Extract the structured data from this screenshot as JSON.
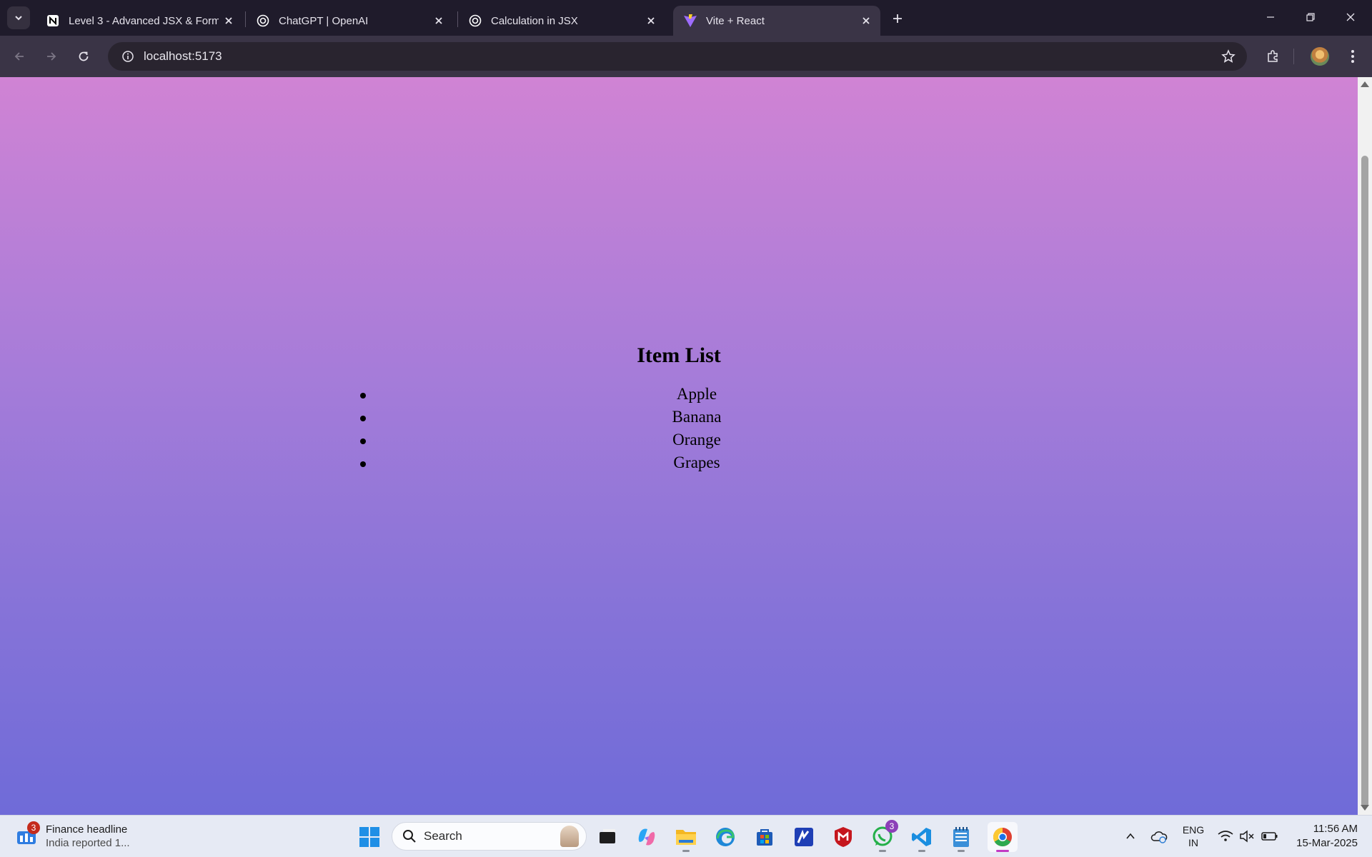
{
  "browser": {
    "tabs": [
      {
        "title": "Level 3 - Advanced JSX & Form",
        "icon": "notion-icon",
        "active": false
      },
      {
        "title": "ChatGPT | OpenAI",
        "icon": "openai-icon",
        "active": false
      },
      {
        "title": "Calculation in JSX",
        "icon": "openai-icon",
        "active": false
      },
      {
        "title": "Vite + React",
        "icon": "vite-icon",
        "active": true
      }
    ],
    "address": "localhost:5173"
  },
  "page": {
    "heading": "Item List",
    "items": [
      "Apple",
      "Banana",
      "Orange",
      "Grapes"
    ],
    "background_top": "#d083d4",
    "background_bottom": "#6f6bd8"
  },
  "taskbar": {
    "widget": {
      "title": "Finance headline",
      "subtitle": "India reported 1...",
      "badge": "3"
    },
    "search_placeholder": "Search",
    "whatsapp_badge": "3",
    "language": {
      "line1": "ENG",
      "line2": "IN"
    },
    "time": "11:56 AM",
    "date": "15-Mar-2025"
  }
}
